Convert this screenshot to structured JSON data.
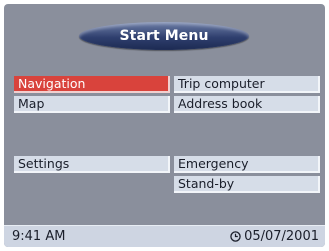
{
  "header": {
    "title": "Start Menu"
  },
  "menu": {
    "left": [
      {
        "label": "Navigation",
        "selected": true
      },
      {
        "label": "Map",
        "selected": false
      },
      {
        "label": "Settings",
        "selected": false
      }
    ],
    "right": [
      {
        "label": "Trip computer"
      },
      {
        "label": "Address book"
      },
      {
        "label": "Emergency"
      },
      {
        "label": "Stand-by"
      }
    ]
  },
  "status": {
    "time": "9:41 AM",
    "date": "05/07/2001",
    "date_icon": "clock-icon"
  },
  "colors": {
    "panel": "#8a8f9c",
    "button": "#d6dde8",
    "selected": "#d9433c",
    "title_pill": "#2f3f6e"
  }
}
